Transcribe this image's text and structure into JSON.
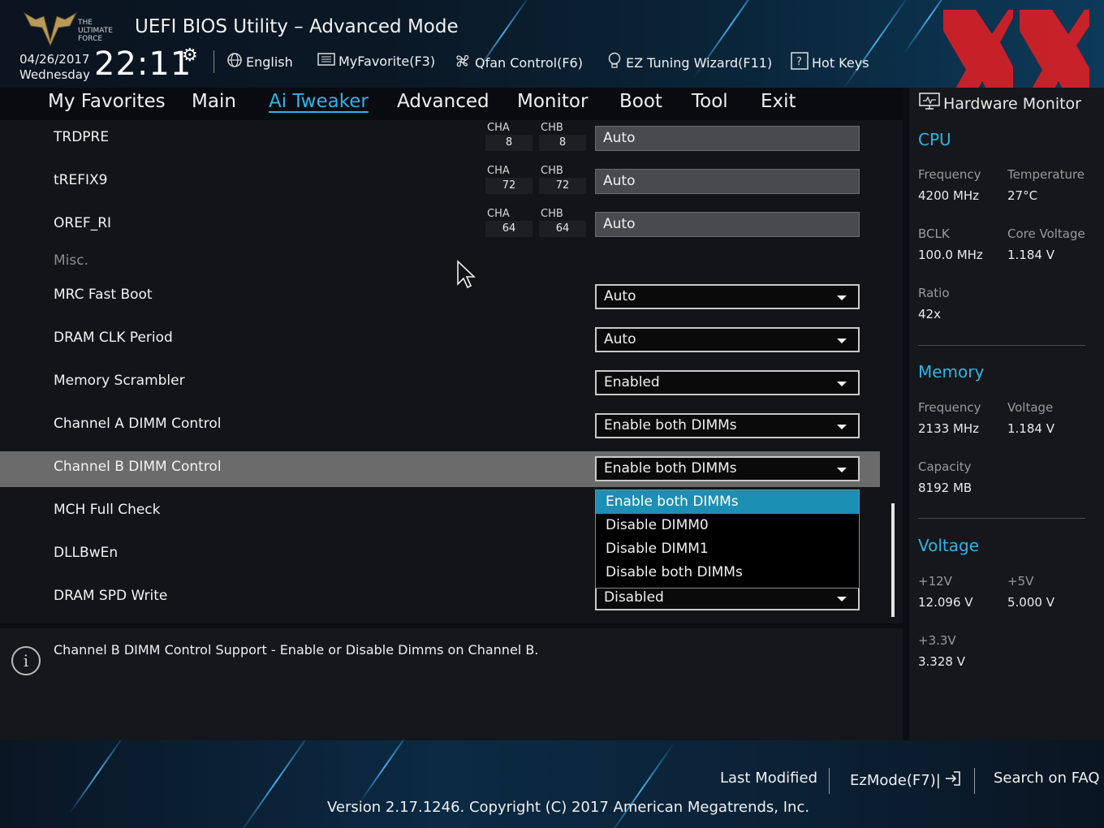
{
  "header": {
    "title": "UEFI BIOS Utility – Advanced Mode",
    "date": "04/26/2017",
    "weekday": "Wednesday",
    "time": "22:11",
    "logo_text": "THE ULTIMATE FORCE",
    "items": [
      {
        "label": "English",
        "icon": "globe-icon"
      },
      {
        "label": "MyFavorite(F3)",
        "icon": "favorites-icon"
      },
      {
        "label": "Qfan Control(F6)",
        "icon": "fan-icon"
      },
      {
        "label": "EZ Tuning Wizard(F11)",
        "icon": "bulb-icon"
      },
      {
        "label": "Hot Keys",
        "icon": "help-icon"
      }
    ]
  },
  "nav": {
    "tabs": [
      "My Favorites",
      "Main",
      "Ai Tweaker",
      "Advanced",
      "Monitor",
      "Boot",
      "Tool",
      "Exit"
    ],
    "active": "Ai Tweaker"
  },
  "settings": {
    "channel_rows": [
      {
        "label": "TRDPRE",
        "cha_label": "CHA",
        "cha": "8",
        "chb_label": "CHB",
        "chb": "8",
        "value": "Auto"
      },
      {
        "label": "tREFIX9",
        "cha_label": "CHA",
        "cha": "72",
        "chb_label": "CHB",
        "chb": "72",
        "value": "Auto"
      },
      {
        "label": "OREF_RI",
        "cha_label": "CHA",
        "cha": "64",
        "chb_label": "CHB",
        "chb": "64",
        "value": "Auto"
      }
    ],
    "misc_label": "Misc.",
    "select_rows": [
      {
        "label": "MRC Fast Boot",
        "value": "Auto"
      },
      {
        "label": "DRAM CLK Period",
        "value": "Auto"
      },
      {
        "label": "Memory Scrambler",
        "value": "Enabled"
      },
      {
        "label": "Channel A DIMM Control",
        "value": "Enable both DIMMs"
      },
      {
        "label": "Channel B DIMM Control",
        "value": "Enable both DIMMs"
      },
      {
        "label": "MCH Full Check",
        "value": ""
      },
      {
        "label": "DLLBwEn",
        "value": ""
      },
      {
        "label": "DRAM SPD Write",
        "value": "Disabled"
      }
    ],
    "dropdown_options": [
      "Enable both DIMMs",
      "Disable DIMM0",
      "Disable DIMM1",
      "Disable both DIMMs"
    ],
    "dropdown_highlighted": "Enable both DIMMs"
  },
  "description": "Channel B DIMM Control Support - Enable or Disable Dimms on Channel B.",
  "hardware_monitor": {
    "title": "Hardware Monitor",
    "cpu": {
      "heading": "CPU",
      "frequency_label": "Frequency",
      "frequency": "4200 MHz",
      "temperature_label": "Temperature",
      "temperature": "27°C",
      "bclk_label": "BCLK",
      "bclk": "100.0 MHz",
      "core_voltage_label": "Core Voltage",
      "core_voltage": "1.184 V",
      "ratio_label": "Ratio",
      "ratio": "42x"
    },
    "memory": {
      "heading": "Memory",
      "frequency_label": "Frequency",
      "frequency": "2133 MHz",
      "voltage_label": "Voltage",
      "voltage": "1.184 V",
      "capacity_label": "Capacity",
      "capacity": "8192 MB"
    },
    "voltage": {
      "heading": "Voltage",
      "v12_label": "+12V",
      "v12": "12.096 V",
      "v5_label": "+5V",
      "v5": "5.000 V",
      "v33_label": "+3.3V",
      "v33": "3.328 V"
    }
  },
  "footer": {
    "last_modified": "Last Modified",
    "ezmode": "EzMode(F7)|",
    "search_faq": "Search on FAQ",
    "version": "Version 2.17.1246. Copyright (C) 2017 American Megatrends, Inc."
  },
  "colors": {
    "accent": "#2fb3e6",
    "selection": "#1c8fb5",
    "watermark": "#d71f26"
  }
}
